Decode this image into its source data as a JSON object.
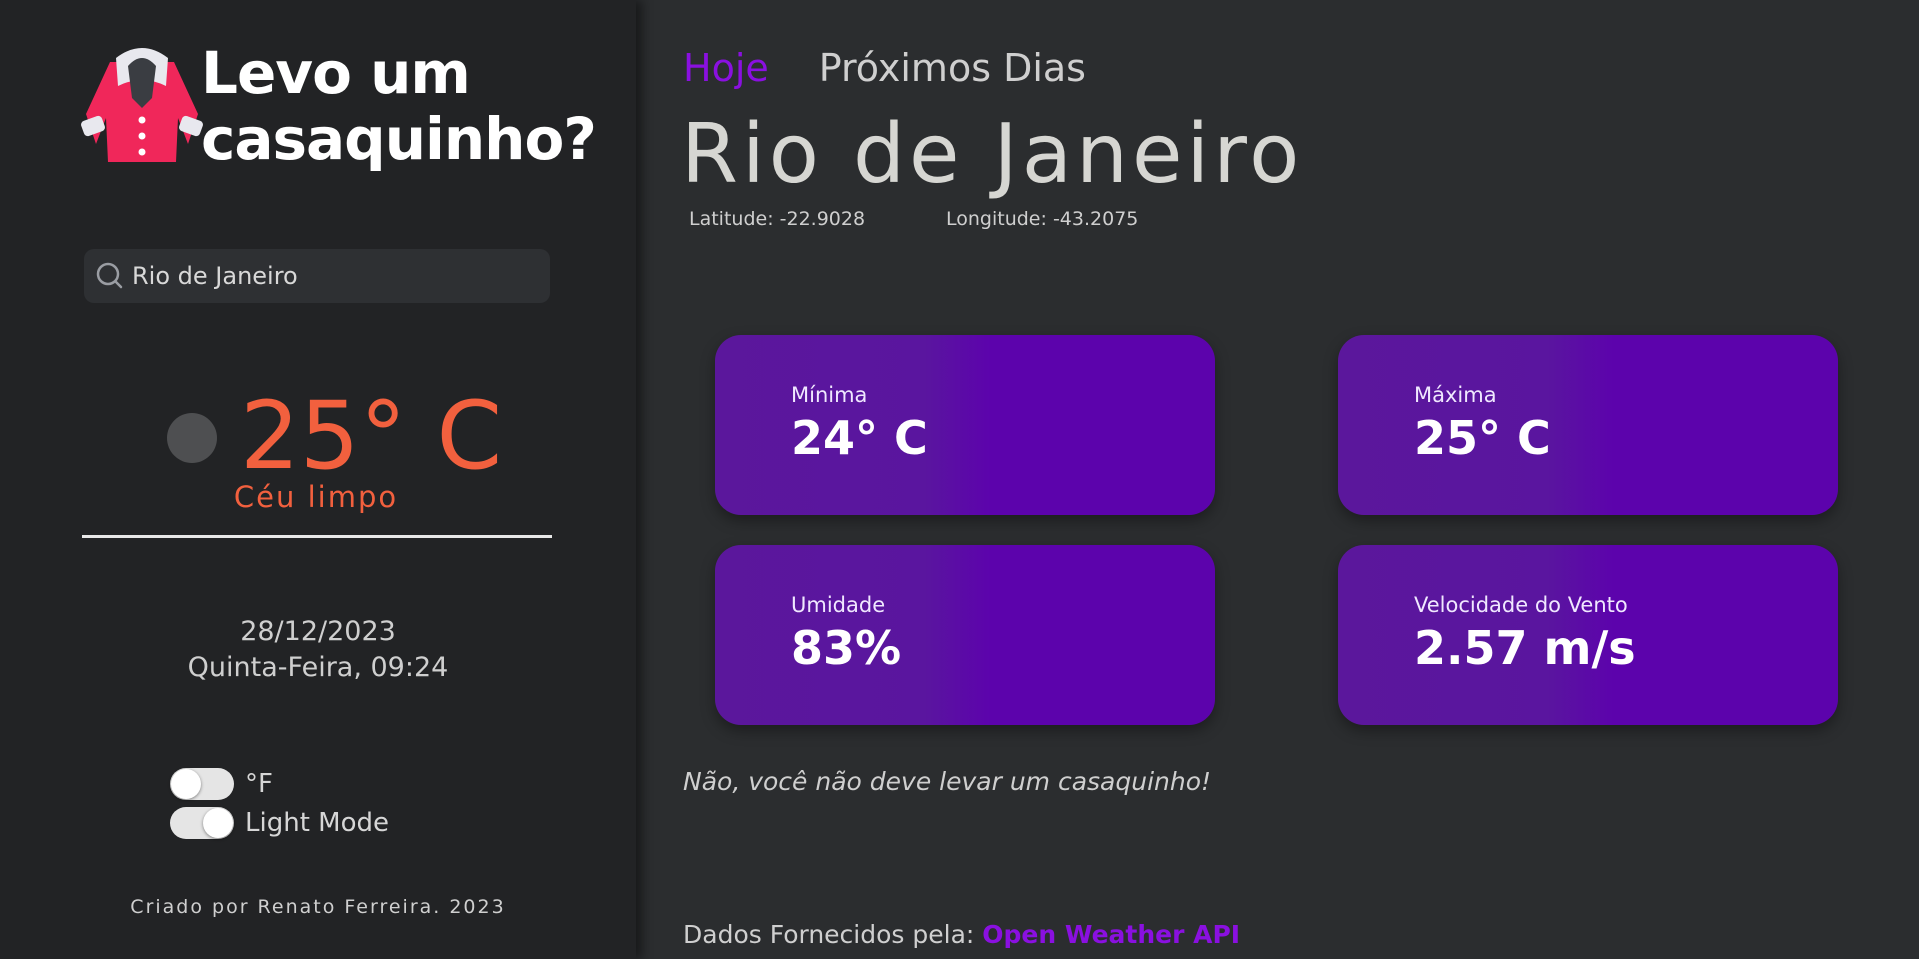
{
  "sidebar": {
    "title_line1": "Levo um",
    "title_line2": "casaquinho?",
    "logo_icon": "coat-icon",
    "search": {
      "value": "Rio de Janeiro",
      "icon": "search-icon"
    },
    "current": {
      "weather_icon": "clear-sky-icon",
      "temperature": "25° C",
      "description": "Céu limpo"
    },
    "date": "28/12/2023",
    "weekday_time": "Quinta-Feira, 09:24",
    "toggles": [
      {
        "label": "°F",
        "checked": false
      },
      {
        "label": "Light Mode",
        "checked": true
      }
    ],
    "credit": "Criado por Renato Ferreira. 2023"
  },
  "main": {
    "tabs": [
      {
        "label": "Hoje",
        "active": true
      },
      {
        "label": "Próximos Dias",
        "active": false
      }
    ],
    "city": "Rio de Janeiro",
    "latitude": "Latitude: -22.9028",
    "longitude": "Longitude: -43.2075",
    "cards": [
      {
        "label": "Mínima",
        "value": "24° C"
      },
      {
        "label": "Máxima",
        "value": "25° C"
      },
      {
        "label": "Umidade",
        "value": "83%"
      },
      {
        "label": "Velocidade do Vento",
        "value": "2.57 m/s"
      }
    ],
    "advice": "Não, você não deve levar um casaquinho!",
    "footer": {
      "prefix": "Dados Fornecidos pela: ",
      "link_text": "Open Weather API"
    }
  },
  "colors": {
    "accent": "#8a10e0",
    "temperature": "#f2603e",
    "card": "#5c03ac",
    "sidebar_bg": "#222325",
    "main_bg": "#2b2d2f"
  }
}
